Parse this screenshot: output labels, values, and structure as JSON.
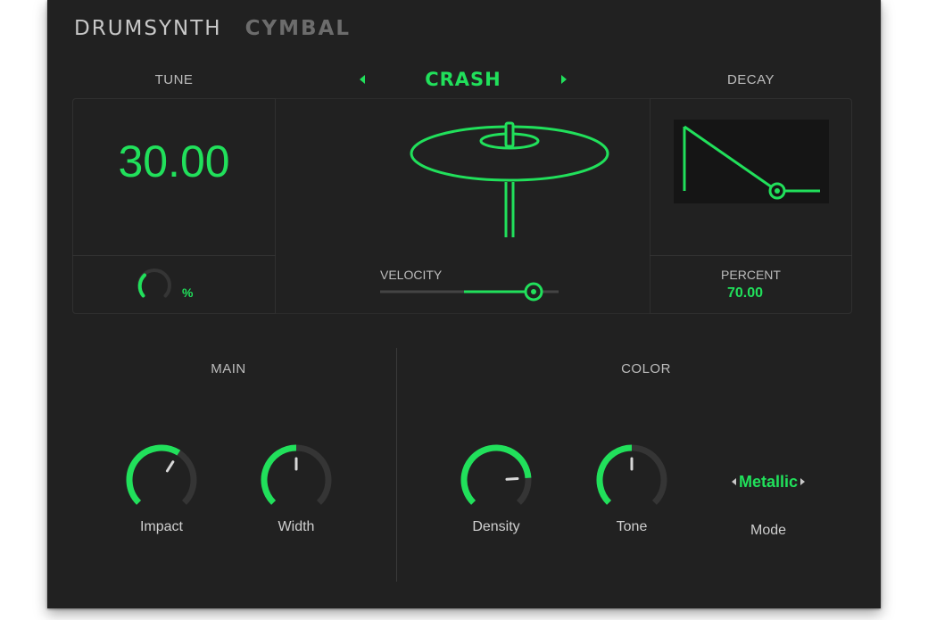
{
  "header": {
    "brand": "DRUMSYNTH",
    "instrument": "CYMBAL"
  },
  "tune": {
    "title": "TUNE",
    "value": "30.00",
    "knob_unit": "%"
  },
  "preset": {
    "name": "CRASH"
  },
  "velocity": {
    "label": "VELOCITY",
    "level": 0.9
  },
  "decay": {
    "title": "DECAY",
    "percent_label": "PERCENT",
    "percent_value": "70.00"
  },
  "main": {
    "title": "MAIN",
    "knobs": [
      {
        "label": "Impact",
        "level": 0.62
      },
      {
        "label": "Width",
        "level": 0.5
      }
    ]
  },
  "color": {
    "title": "COLOR",
    "knobs": [
      {
        "label": "Density",
        "level": 0.82
      },
      {
        "label": "Tone",
        "level": 0.5
      }
    ],
    "mode": {
      "value": "Metallic",
      "label": "Mode"
    }
  },
  "colors": {
    "accent": "#21e05b",
    "background": "#212121",
    "track": "#353535"
  }
}
